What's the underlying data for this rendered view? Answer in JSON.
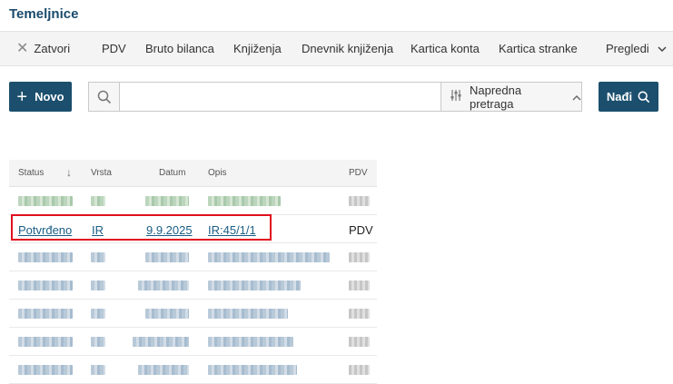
{
  "page": {
    "title": "Temeljnice"
  },
  "toolbar": {
    "close_label": "Zatvori",
    "items": [
      "PDV",
      "Bruto bilanca",
      "Knjiženja",
      "Dnevnik knjiženja",
      "Kartica konta",
      "Kartica stranke",
      "Pregledi"
    ]
  },
  "actions": {
    "new_label": "Novo",
    "find_label": "Nađi"
  },
  "search": {
    "placeholder": "",
    "value": "",
    "advanced_label": "Napredna pretraga"
  },
  "table": {
    "columns": [
      "Status",
      "Vrsta",
      "Datum",
      "Opis",
      "PDV"
    ],
    "sort_column": "Status",
    "highlighted_row": {
      "status": "Potvrđeno",
      "type": "IR",
      "date": "9.9.2025",
      "description": "IR:45/1/1",
      "vat": "PDV"
    }
  },
  "colors": {
    "primary": "#1b4f6d",
    "link": "#1a5e86",
    "highlight_border": "#e0101e",
    "toolbar_bg": "#f4f4f4"
  },
  "icons": {
    "close": "close-icon",
    "plus": "plus-icon",
    "search": "search-icon",
    "sliders": "sliders-icon",
    "caret_up": "chevron-up-icon",
    "more": "chevron-down-icon",
    "sort": "arrow-down-icon"
  }
}
